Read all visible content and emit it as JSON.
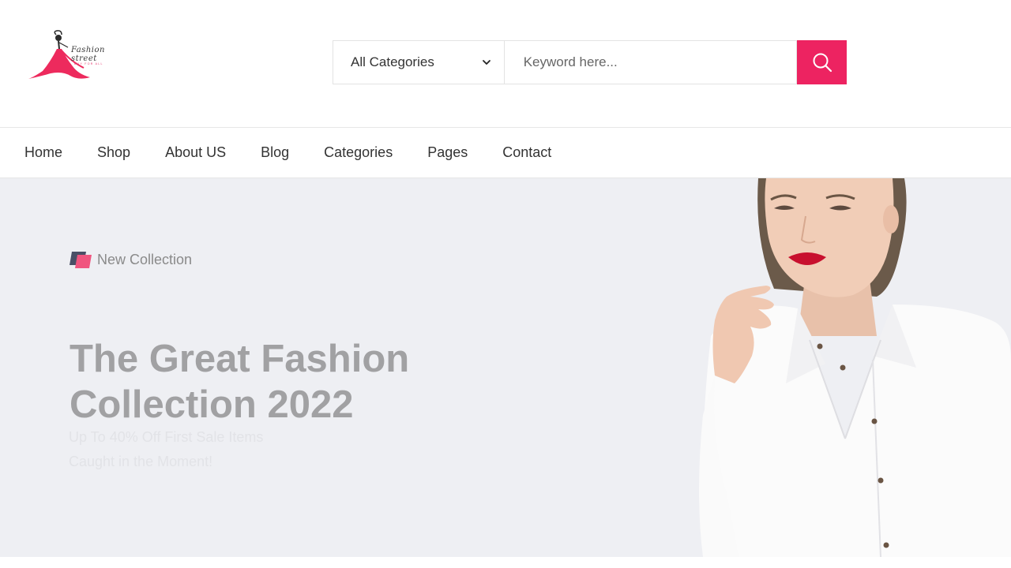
{
  "brand": {
    "logo_text": "Fashion street",
    "logo_tagline": "BUY FOR ALL"
  },
  "search": {
    "category_selected": "All Categories",
    "keyword_placeholder": "Keyword here...",
    "accent_color": "#ed2361"
  },
  "nav": {
    "items": [
      {
        "label": "Home"
      },
      {
        "label": "Shop"
      },
      {
        "label": "About US"
      },
      {
        "label": "Blog"
      },
      {
        "label": "Categories"
      },
      {
        "label": "Pages"
      },
      {
        "label": "Contact"
      }
    ]
  },
  "hero": {
    "badge_label": "New Collection",
    "headline": "The Great Fashion Collection 2022",
    "subline_1": "Up To 40% Off First Sale Items",
    "subline_2": "Caught in the Moment!",
    "background_color": "#eeeff3"
  }
}
